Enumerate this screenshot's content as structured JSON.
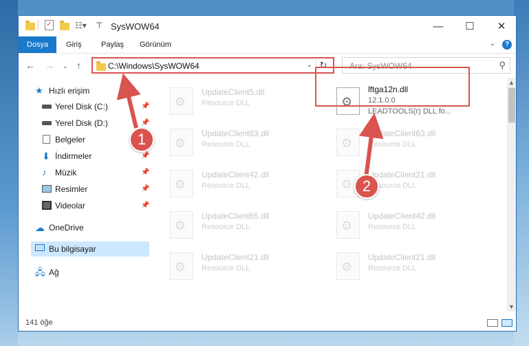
{
  "titlebar": {
    "title": "SysWOW64"
  },
  "ribbon": {
    "tabs": [
      "Dosya",
      "Giriş",
      "Paylaş",
      "Görünüm"
    ]
  },
  "address": {
    "path": "C:\\Windows\\SysWOW64"
  },
  "search": {
    "placeholder": "Ara: SysWOW64"
  },
  "sidebar": {
    "items": [
      {
        "label": "Hızlı erişim",
        "icon": "star-icon"
      },
      {
        "label": "Yerel Disk (C:)",
        "icon": "drive-icon"
      },
      {
        "label": "Yerel Disk (D:)",
        "icon": "drive-icon"
      },
      {
        "label": "Belgeler",
        "icon": "documents-icon"
      },
      {
        "label": "İndirmeler",
        "icon": "download-icon"
      },
      {
        "label": "Müzik",
        "icon": "music-icon"
      },
      {
        "label": "Resimler",
        "icon": "pictures-icon"
      },
      {
        "label": "Videolar",
        "icon": "video-icon"
      },
      {
        "label": "OneDrive",
        "icon": "cloud-icon"
      },
      {
        "label": "Bu bilgisayar",
        "icon": "computer-icon"
      },
      {
        "label": "Ağ",
        "icon": "network-icon"
      }
    ]
  },
  "files": [
    {
      "name": "UpdateClient5.dll",
      "desc": "Resource DLL"
    },
    {
      "name": "lftga12n.dll",
      "version": "12.1.0.0",
      "desc": "LEADTOOLS(r) DLL fo..."
    },
    {
      "name": "UpdateClient63.dll",
      "desc": "Resource DLL"
    },
    {
      "name": "UpdateClient63.dll",
      "desc": "Resource DLL"
    },
    {
      "name": "UpdateClient42.dll",
      "desc": "Resource DLL"
    },
    {
      "name": "UpdateClient21.dll",
      "desc": "Resource DLL"
    },
    {
      "name": "UpdateClient65.dll",
      "desc": "Resource DLL"
    },
    {
      "name": "UpdateClient42.dll",
      "desc": "Resource DLL"
    },
    {
      "name": "UpdateClient21.dll",
      "desc": "Resource DLL"
    },
    {
      "name": "UpdateClient21.dll",
      "desc": "Resource DLL"
    }
  ],
  "status": {
    "count": "141 öğe"
  },
  "callouts": [
    "1",
    "2"
  ],
  "colors": {
    "accent": "#1979ca",
    "highlight": "#d9534f"
  }
}
